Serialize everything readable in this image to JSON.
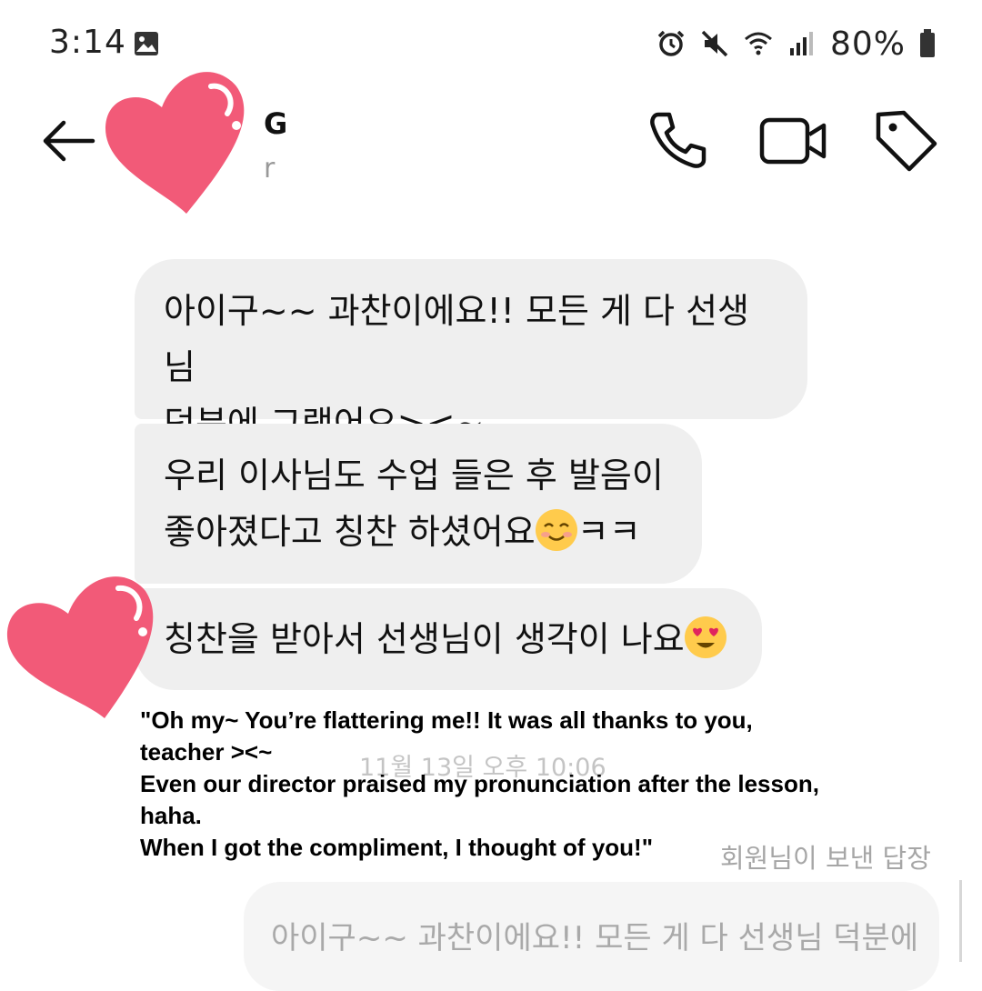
{
  "status_bar": {
    "time": "3:14",
    "battery": "80%",
    "icons": [
      "gallery-icon",
      "alarm-icon",
      "mute-icon",
      "wifi-icon",
      "signal-icon",
      "battery-icon"
    ]
  },
  "header": {
    "contact_name": "G",
    "contact_subtitle": "r",
    "icons": [
      "back-arrow-icon",
      "phone-icon",
      "video-icon",
      "tag-icon"
    ]
  },
  "messages": [
    {
      "line1": "아이구~~ 과찬이에요!! 모든 게 다 선생님",
      "line2": "덕분에 그랬어요><~"
    },
    {
      "line1": "우리 이사님도 수업 들은 후 발음이",
      "line2_before": "좋아졌다고 칭찬 하셨어요",
      "line2_after": "ㅋㅋ",
      "emoji": "smiling-face-emoji"
    },
    {
      "line1": "칭찬을 받아서 선생님이 생각이 나요",
      "emoji": "heart-eyes-emoji"
    }
  ],
  "timestamp": "11월 13일 오후 10:06",
  "translation": [
    "\"Oh my~ You’re flattering me!! It was all thanks to you,",
    "teacher ><~",
    "Even our director praised my pronunciation after the lesson,",
    "haha.",
    "When I got the compliment, I thought of you!\""
  ],
  "reply": {
    "label": "회원님이 보낸 답장",
    "preview": "아이구~~ 과찬이에요!! 모든 게 다 선생님 덕분에"
  },
  "colors": {
    "bubble": "#efefef",
    "heart": "#f25a78",
    "timestamp": "#c4c4c4"
  }
}
